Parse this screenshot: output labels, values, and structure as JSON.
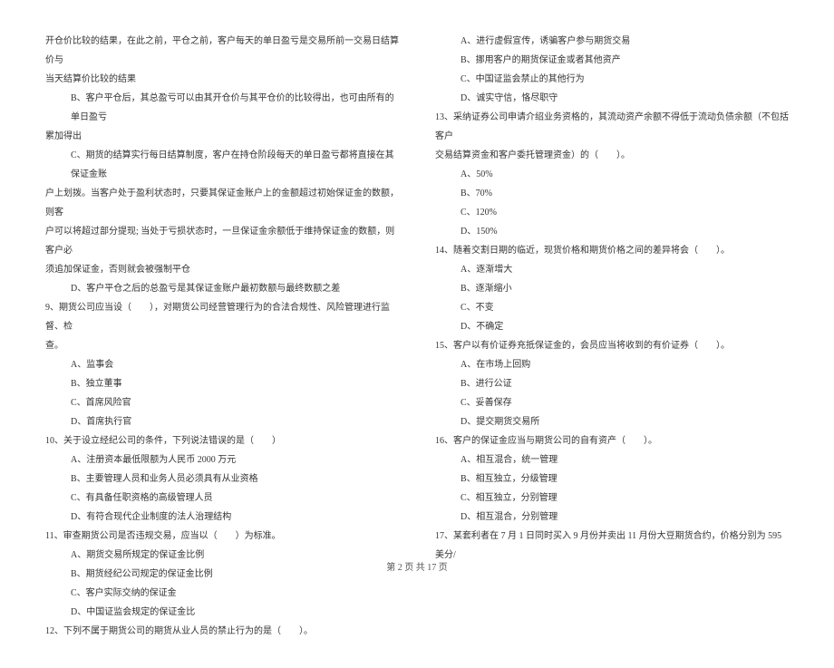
{
  "left": {
    "l1": "开仓价比较的结果，在此之前，平仓之前，客户每天的单日盈亏是交易所前一交易日结算价与",
    "l2": "当天结算价比较的结果",
    "l3": "B、客户平仓后，其总盈亏可以由其开仓价与其平仓价的比较得出，也可由所有的单日盈亏",
    "l4": "累加得出",
    "l5": "C、期货的结算实行每日结算制度，客户在持仓阶段每天的单日盈亏都将直接在其保证金账",
    "l6": "户上划拨。当客户处于盈利状态时，只要其保证金账户上的金额超过初始保证金的数额，则客",
    "l7": "户可以将超过部分提现; 当处于亏损状态时，一旦保证金余额低于维持保证金的数额，则客户必",
    "l8": "须追加保证金，否则就会被强制平仓",
    "l9": "D、客户平仓之后的总盈亏是其保证金账户最初数额与最终数额之差",
    "l10": "9、期货公司应当设（　　），对期货公司经营管理行为的合法合规性、风险管理进行监督、检",
    "l11": "查。",
    "l12": "A、监事会",
    "l13": "B、独立董事",
    "l14": "C、首席风险官",
    "l15": "D、首席执行官",
    "l16": "10、关于设立经纪公司的条件，下列说法错误的是（　　）",
    "l17": "A、注册资本最低限额为人民币 2000 万元",
    "l18": "B、主要管理人员和业务人员必须具有从业资格",
    "l19": "C、有具备任职资格的高级管理人员",
    "l20": "D、有符合现代企业制度的法人治理结构",
    "l21": "11、审查期货公司是否违规交易，应当以（　　）为标准。",
    "l22": "A、期货交易所规定的保证金比例",
    "l23": "B、期货经纪公司规定的保证金比例",
    "l24": "C、客户实际交纳的保证金",
    "l25": "D、中国证监会规定的保证金比",
    "l26": "12、下列不属于期货公司的期货从业人员的禁止行为的是（　　）。"
  },
  "right": {
    "r1": "A、进行虚假宣传，诱骗客户参与期货交易",
    "r2": "B、挪用客户的期货保证金或者其他资产",
    "r3": "C、中国证监会禁止的其他行为",
    "r4": "D、诚实守信，恪尽职守",
    "r5": "13、采纳证券公司申请介绍业务资格的，其流动资产余额不得低于流动负债余额（不包括客户",
    "r6": "交易结算资金和客户委托管理资金）的（　　）。",
    "r7": "A、50%",
    "r8": "B、70%",
    "r9": "C、120%",
    "r10": "D、150%",
    "r11": "14、随着交割日期的临近，现货价格和期货价格之间的差异将会（　　）。",
    "r12": "A、逐渐增大",
    "r13": "B、逐渐缩小",
    "r14": "C、不变",
    "r15": "D、不确定",
    "r16": "15、客户以有价证券充抵保证金的，会员应当将收到的有价证券（　　）。",
    "r17": "A、在市场上回购",
    "r18": "B、进行公证",
    "r19": "C、妥善保存",
    "r20": "D、提交期货交易所",
    "r21": "16、客户的保证金应当与期货公司的自有资产（　　）。",
    "r22": "A、相互混合，统一管理",
    "r23": "B、相互独立，分级管理",
    "r24": "C、相互独立，分别管理",
    "r25": "D、相互混合，分别管理",
    "r26": "17、某套利者在 7 月 1 日同时买入 9 月份并卖出 11 月份大豆期货合约，价格分别为 595 美分/"
  },
  "footer": "第 2 页 共 17 页"
}
